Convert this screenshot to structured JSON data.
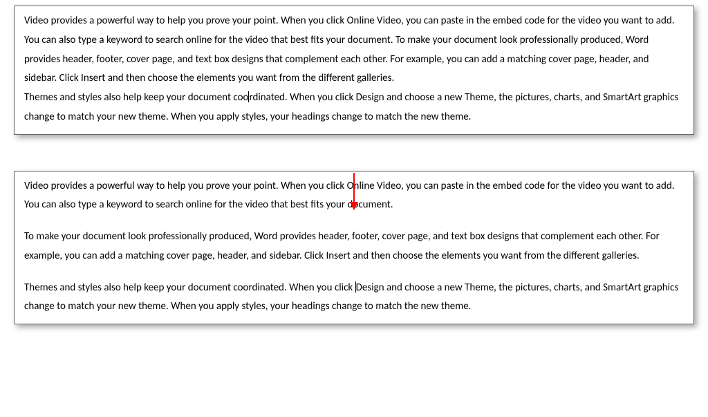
{
  "top": {
    "p1a": "Video provides a powerful way to help you prove your point. When you click Online Video, you can paste in the embed code for the video you want to add. You can also type a keyword to search online for the video that best fits your document.",
    "p1b": "To make your document look professionally produced, Word provides header, footer, cover page, and text box designs that complement each other. For example, you can add a matching cover page, header, and sidebar. Click Insert and then choose the elements you want from the different galleries.",
    "p2_before": "Themes and styles also help keep your document coo",
    "p2_after": "rdinated. When you click Design and choose a new Theme, the pictures, charts, and SmartArt graphics change to match your new theme. When you apply styles, your headings change to match the new theme."
  },
  "bottom": {
    "p1": "Video provides a powerful way to help you prove your point. When you click Online Video, you can paste in the embed code for the video you want to add. You can also type a keyword to search online for the video that best fits your document.",
    "p2": "To make your document look professionally produced, Word provides header, footer, cover page, and text box designs that complement each other. For example, you can add a matching cover page, header, and sidebar. Click Insert and then choose the elements you want from the different galleries.",
    "p3_before": "Themes and styles also help keep your document coordinated. When you click ",
    "p3_after": "Design and choose a new Theme, the pictures, charts, and SmartArt graphics change to match your new theme. When you apply styles, your headings change to match the new theme."
  }
}
